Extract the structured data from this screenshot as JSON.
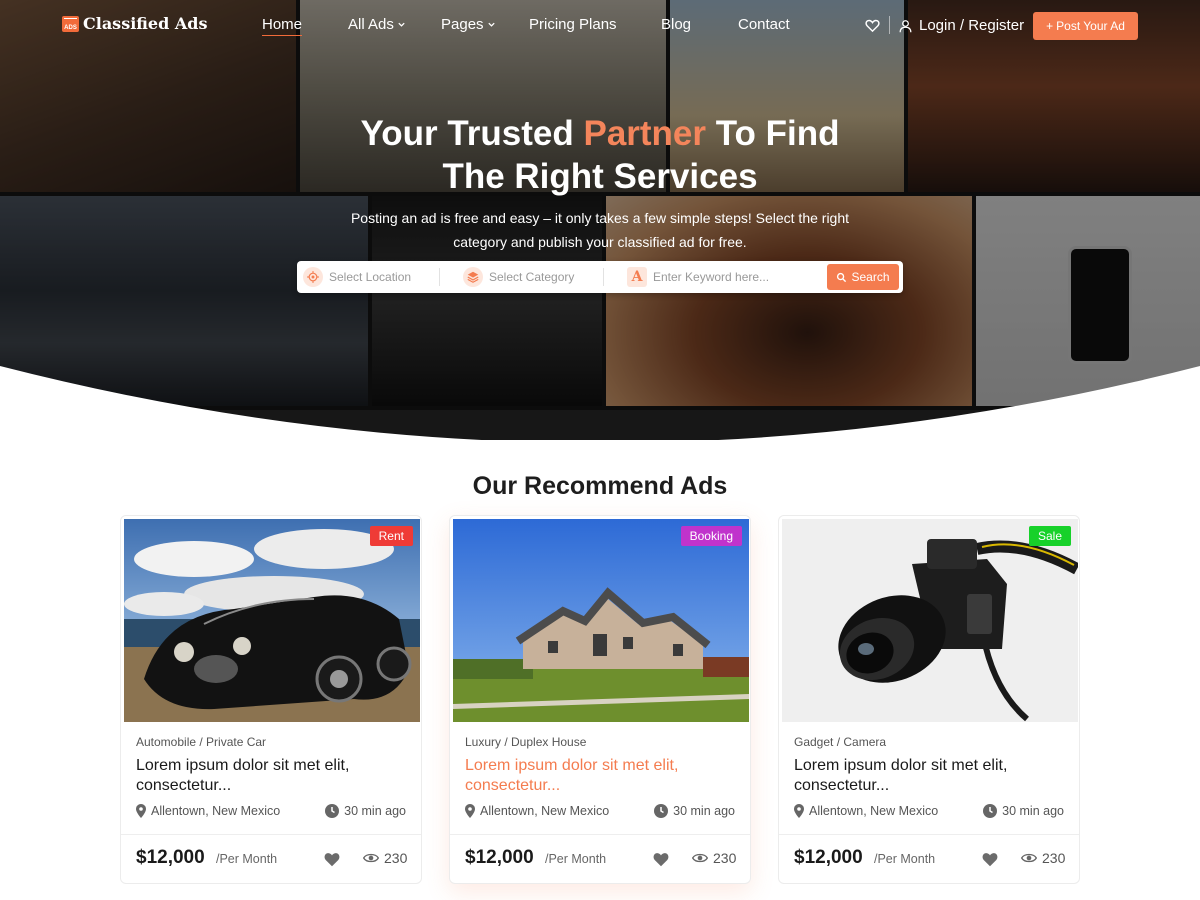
{
  "site": {
    "logo_badge": "ADS",
    "logo_text": "Classified Ads"
  },
  "nav": {
    "items": [
      {
        "label": "Home",
        "active": true
      },
      {
        "label": "All Ads",
        "dropdown": true
      },
      {
        "label": "Pages",
        "dropdown": true
      },
      {
        "label": "Pricing Plans"
      },
      {
        "label": "Blog"
      },
      {
        "label": "Contact"
      }
    ],
    "login_label": "Login / Register",
    "post_button": "Post Your Ad",
    "post_button_icon": "+"
  },
  "hero": {
    "title_part1": "Your Trusted ",
    "title_accent": "Partner",
    "title_part2": " To Find",
    "title_line2": "The Right Services",
    "description": "Posting an ad is free and easy – it only takes a few simple steps! Select the right category and publish your classified ad for free."
  },
  "search": {
    "location_placeholder": "Select Location",
    "category_placeholder": "Select Category",
    "keyword_placeholder": "Enter Keyword here...",
    "button_label": "Search",
    "keyword_icon_letter": "A"
  },
  "section": {
    "title": "Our Recommend Ads"
  },
  "cards": [
    {
      "badge": "Rent",
      "badge_color": "#ef3b36",
      "category": "Automobile / Private Car",
      "title": "Lorem ipsum dolor sit met elit, consectetur...",
      "location": "Allentown, New Mexico",
      "time": "30 min ago",
      "price": "$12,000",
      "per": "/Per Month",
      "views": "230",
      "image": "vintage-car-photo"
    },
    {
      "badge": "Booking",
      "badge_color": "#c033cc",
      "category": "Luxury / Duplex House",
      "title": "Lorem ipsum dolor sit met elit, consectetur...",
      "location": "Allentown, New Mexico",
      "time": "30 min ago",
      "price": "$12,000",
      "per": "/Per Month",
      "views": "230",
      "image": "house-photo"
    },
    {
      "badge": "Sale",
      "badge_color": "#17d12a",
      "category": "Gadget / Camera",
      "title": "Lorem ipsum dolor sit met elit, consectetur...",
      "location": "Allentown, New Mexico",
      "time": "30 min ago",
      "price": "$12,000",
      "per": "/Per Month",
      "views": "230",
      "image": "dslr-camera-photo"
    }
  ],
  "colors": {
    "accent": "#f47c4f",
    "dark_text": "#1c1c1c"
  }
}
